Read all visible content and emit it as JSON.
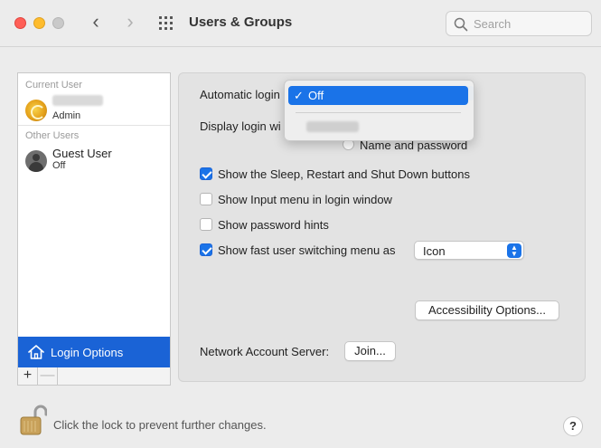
{
  "window": {
    "title": "Users & Groups",
    "search_placeholder": "Search"
  },
  "sidebar": {
    "current_user_label": "Current User",
    "current_user_role": "Admin",
    "other_users_label": "Other Users",
    "guest_name": "Guest User",
    "guest_status": "Off",
    "login_options_label": "Login Options",
    "add_label": "+",
    "remove_label": "—"
  },
  "main": {
    "automatic_login_label": "Automatic login",
    "automatic_login_value": "Off",
    "display_login_label": "Display login wi",
    "name_and_password_label": "Name and password",
    "checkboxes": [
      {
        "label": "Show the Sleep, Restart and Shut Down buttons",
        "checked": true
      },
      {
        "label": "Show Input menu in login window",
        "checked": false
      },
      {
        "label": "Show password hints",
        "checked": false
      },
      {
        "label": "Show fast user switching menu as",
        "checked": true
      }
    ],
    "fast_user_switching_value": "Icon",
    "accessibility_button": "Accessibility Options...",
    "network_account_label": "Network Account Server:",
    "join_button": "Join..."
  },
  "dropdown_menu": {
    "selected_item": "Off",
    "check_mark": "✓"
  },
  "footer": {
    "lock_text": "Click the lock to prevent further changes.",
    "help_label": "?"
  },
  "colors": {
    "accent": "#1a73e8",
    "selection": "#1a63d6"
  }
}
